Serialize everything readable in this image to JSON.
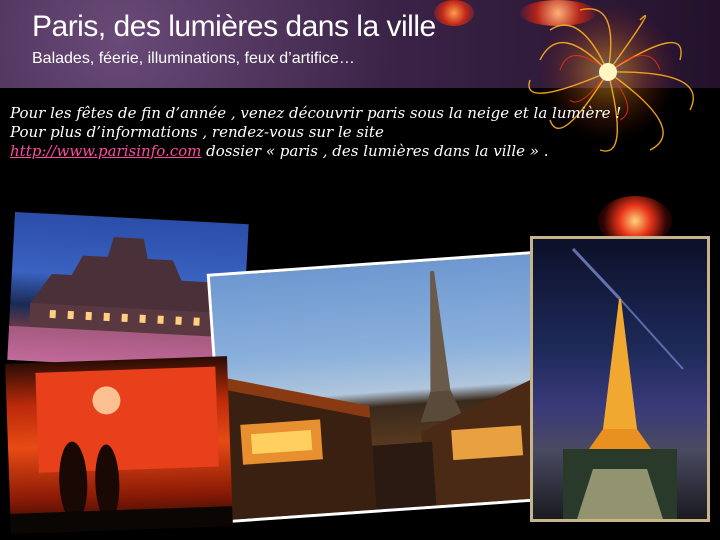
{
  "banner": {
    "title": "Paris, des lumières dans la ville",
    "subtitle": "Balades, féerie, illuminations, feux d’artifice…"
  },
  "intro": {
    "line1": "Pour les fêtes de fin d’année , venez découvrir paris sous la neige et la lumière !",
    "line2": "Pour plus d’informations , rendez-vous sur le site",
    "link": "http://www.parisinfo.com",
    "line3": " dossier « paris , des lumières dans la ville » ."
  },
  "colors": {
    "banner": "#3b2347",
    "link": "#ff4aa0",
    "background": "#000000"
  },
  "photos": [
    {
      "name": "hotel-de-ville-photo"
    },
    {
      "name": "christmas-market-eiffel-photo"
    },
    {
      "name": "eiffel-tower-night-photo"
    },
    {
      "name": "red-stall-photo"
    }
  ]
}
